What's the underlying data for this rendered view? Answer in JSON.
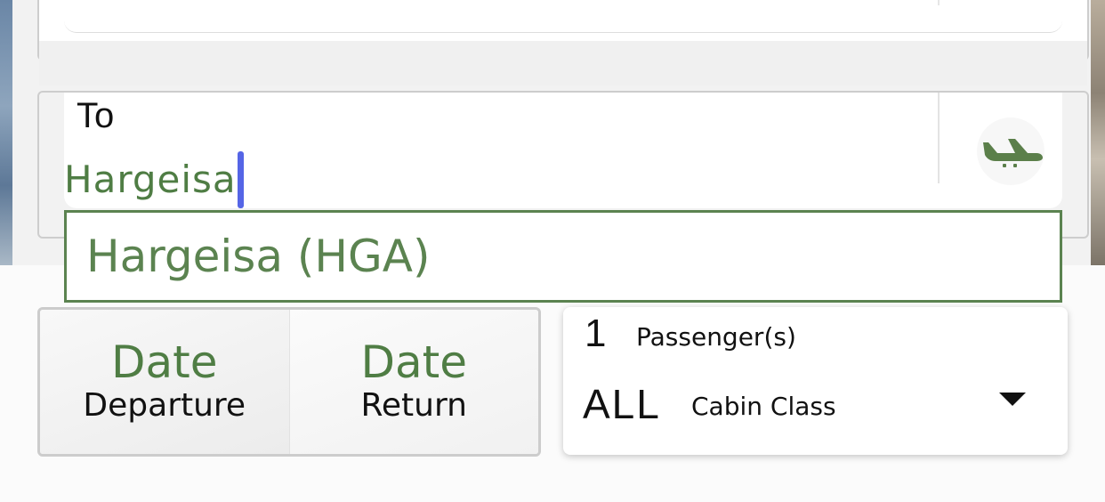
{
  "destination": {
    "label": "To",
    "value": "Hargeisa",
    "icon": "plane-landing-icon",
    "icon_color": "#5b7f4a"
  },
  "suggestions": [
    {
      "label": "Hargeisa (HGA)"
    }
  ],
  "dates": {
    "departure": {
      "value": "Date",
      "label": "Departure"
    },
    "return": {
      "value": "Date",
      "label": "Return"
    }
  },
  "passengers": {
    "count": "1",
    "label": "Passenger(s)"
  },
  "cabin": {
    "value": "ALL",
    "label": "Cabin Class",
    "icon": "caret-down-icon"
  },
  "colors": {
    "accent_green": "#4f7d44",
    "caret_blue": "#5565e6",
    "border_gray": "#cdcdcd"
  }
}
